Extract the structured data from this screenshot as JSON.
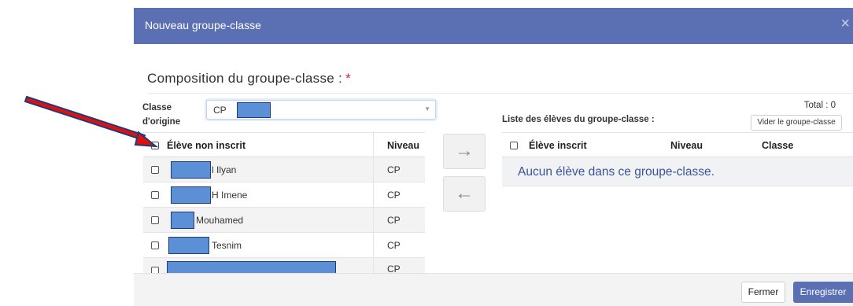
{
  "modal": {
    "title": "Nouveau groupe-classe",
    "close": "×"
  },
  "composition": {
    "title": "Composition du groupe-classe :",
    "required_mark": "*"
  },
  "origin": {
    "label": "Classe d'origine :",
    "value": "CP"
  },
  "left_table": {
    "headers": {
      "student": "Élève non inscrit",
      "level": "Niveau"
    },
    "rows": [
      {
        "name": "l Ilyan",
        "level": "CP"
      },
      {
        "name": "H Imene",
        "level": "CP"
      },
      {
        "name": "Mouhamed",
        "level": "CP"
      },
      {
        "name": "Tesnim",
        "level": "CP"
      },
      {
        "name": "",
        "level": "CP"
      }
    ]
  },
  "transfer": {
    "add_arrow": "→",
    "remove_arrow": "←"
  },
  "right_panel": {
    "list_label": "Liste des élèves du groupe-classe :",
    "total": "Total : 0",
    "clear_button": "Vider le groupe-classe",
    "headers": {
      "student": "Élève inscrit",
      "level": "Niveau",
      "class": "Classe"
    },
    "empty_message": "Aucun élève dans ce groupe-classe."
  },
  "footer": {
    "close_button": "Fermer",
    "save_button": "Enregistrer"
  },
  "colors": {
    "header": "#5b6fb3",
    "redaction": "#5b8fd6",
    "annotation_arrow": "#e01010"
  }
}
